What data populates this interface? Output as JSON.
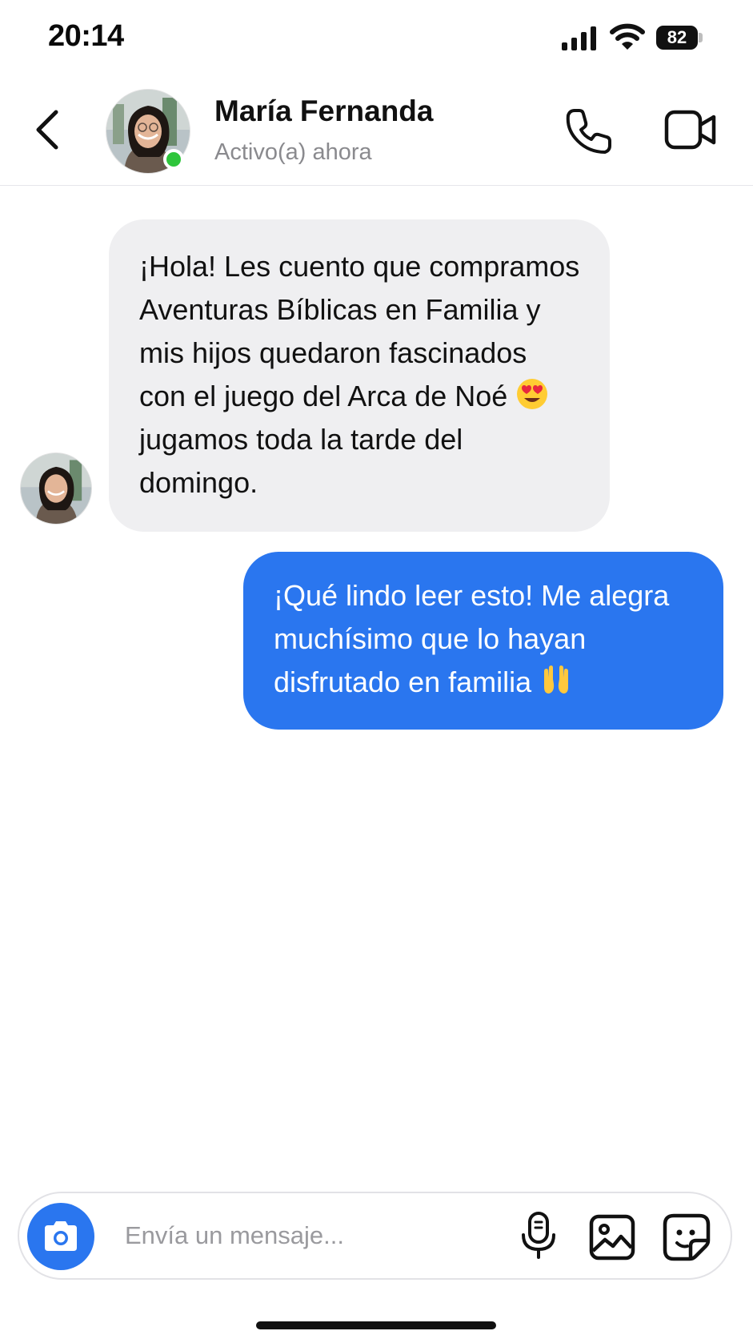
{
  "status_bar": {
    "time": "20:14",
    "battery": "82"
  },
  "header": {
    "contact_name": "María Fernanda",
    "contact_status": "Activo(a) ahora",
    "online_color": "#2ec53b"
  },
  "messages": [
    {
      "direction": "incoming",
      "text_before_emoji": "¡Hola! Les cuento que compramos Aventuras Bíblicas en Familia y mis hijos quedaron fascinados con el juego del Arca de Noé ",
      "emoji": "smiling-face-heart-eyes",
      "text_after_emoji": " jugamos toda la tarde del domingo."
    },
    {
      "direction": "outgoing",
      "text": "¡Qué lindo leer esto! Me alegra muchísimo que lo hayan disfrutado en familia ",
      "emoji": "raising-hands"
    }
  ],
  "composer": {
    "placeholder": "Envía un mensaje...",
    "value": ""
  },
  "colors": {
    "accent": "#2a76ef",
    "incoming_bubble": "#efeff1"
  },
  "icons": [
    "back-chevron-icon",
    "phone-icon",
    "video-camera-icon",
    "camera-icon",
    "microphone-icon",
    "image-icon",
    "sticker-icon"
  ]
}
